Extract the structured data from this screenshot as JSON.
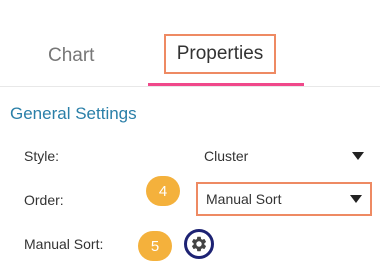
{
  "tabs": {
    "chart": "Chart",
    "properties": "Properties"
  },
  "section": {
    "title": "General Settings"
  },
  "fields": {
    "style": {
      "label": "Style:",
      "value": "Cluster"
    },
    "order": {
      "label": "Order:",
      "value": "Manual Sort"
    },
    "manual_sort": {
      "label": "Manual Sort:",
      "icon": "gear-icon"
    }
  },
  "annotations": {
    "step4": "4",
    "step5": "5"
  },
  "colors": {
    "highlight_border": "#ee8a63",
    "active_tab_underline": "#f0488a",
    "section_title": "#2a7fa8",
    "badge": "#f4b13c",
    "gear_ring": "#1d2273"
  }
}
